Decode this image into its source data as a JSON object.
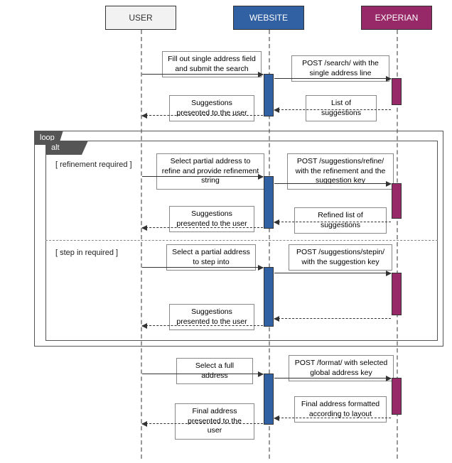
{
  "participants": {
    "user": "USER",
    "website": "WEBSITE",
    "experian": "EXPERIAN"
  },
  "frames": {
    "loop": "loop",
    "alt": "alt"
  },
  "guards": {
    "refinement": "[ refinement required ]",
    "stepin": "[ step in required ]"
  },
  "messages": {
    "fill_search": "Fill out single address field and submit the search",
    "post_search": "POST /search/ with the single address line",
    "list_suggestions": "List of suggestions",
    "suggestions_presented": "Suggestions presented to the user",
    "select_partial_refine": "Select partial address to refine and provide refinement string",
    "post_refine": "POST /suggestions/refine/ with the refinement and the suggestion key",
    "refined_list": "Refined list of suggestions",
    "suggestions_presented_2": "Suggestions presented to the user",
    "select_stepin": "Select a partial address to step into",
    "post_stepin": "POST /suggestions/stepin/ with the suggestion key",
    "suggestions_presented_3": "Suggestions presented to the user",
    "select_full": "Select a full address",
    "post_format": "POST /format/ with selected global address key",
    "final_formatted": "Final address formatted according to layout",
    "final_presented": "Final address presented to the user"
  }
}
